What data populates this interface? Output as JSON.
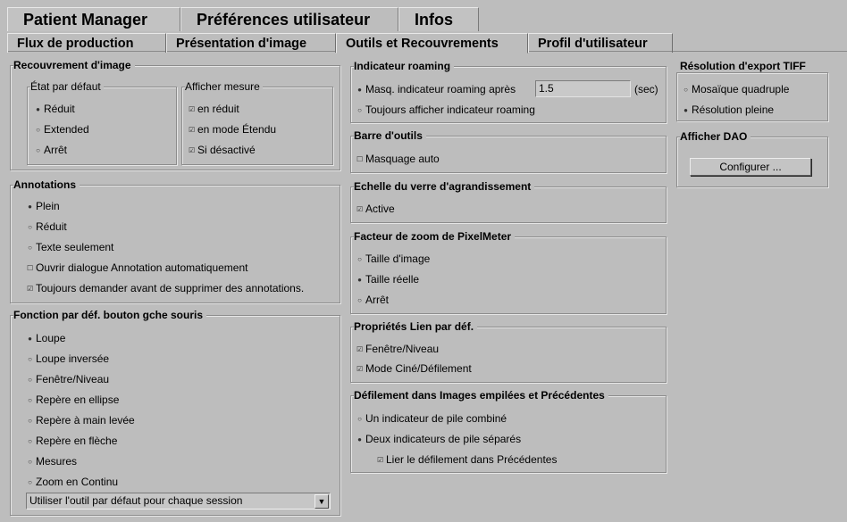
{
  "top_tabs": [
    {
      "label": "Patient Manager",
      "active": false
    },
    {
      "label": "Préférences utilisateur",
      "active": true
    },
    {
      "label": "Infos",
      "active": false
    }
  ],
  "sub_tabs": [
    {
      "label": "Flux de production"
    },
    {
      "label": "Présentation d'image"
    },
    {
      "label": "Outils et Recouvrements"
    },
    {
      "label": "Profil d'utilisateur"
    }
  ],
  "recouvrement": {
    "title": "Recouvrement d'image",
    "etat_title": "État par défaut",
    "etat_options": [
      "Réduit",
      "Extended",
      "Arrêt"
    ],
    "etat_selected": "Réduit",
    "mesure_title": "Afficher mesure",
    "mesure_options": [
      {
        "label": "en réduit",
        "checked": true
      },
      {
        "label": "en mode Étendu",
        "checked": true
      },
      {
        "label": "Si désactivé",
        "checked": true
      }
    ]
  },
  "annotations": {
    "title": "Annotations",
    "options": [
      "Plein",
      "Réduit",
      "Texte seulement"
    ],
    "selected": "Plein",
    "checks": [
      {
        "label": "Ouvrir dialogue Annotation automatiquement",
        "checked": false
      },
      {
        "label": "Toujours demander avant de supprimer des annotations.",
        "checked": true
      }
    ]
  },
  "mouse": {
    "title": "Fonction par déf. bouton gche souris",
    "options": [
      "Loupe",
      "Loupe inversée",
      "Fenêtre/Niveau",
      "Repère en ellipse",
      "Repère à main levée",
      "Repère en flèche",
      "Mesures",
      "Zoom en Continu"
    ],
    "selected": "Loupe",
    "dropdown_value": "Utiliser l'outil par défaut pour chaque session",
    "dropdown_arrow": "▼"
  },
  "roaming": {
    "title": "Indicateur roaming",
    "hide_label": "Masq. indicateur roaming après",
    "hide_value": "1.5",
    "unit": "(sec)",
    "always_label": "Toujours afficher indicateur roaming",
    "selected": "hide"
  },
  "toolbar_box": {
    "title": "Barre d'outils",
    "auto_hide_label": "Masquage auto",
    "auto_hide_checked": false
  },
  "magnifier": {
    "title": "Echelle du verre d'agrandissement",
    "active_label": "Active",
    "active_checked": true
  },
  "pixelmeter": {
    "title": "Facteur de zoom de PixelMeter",
    "options": [
      "Taille d'image",
      "Taille réelle",
      "Arrêt"
    ],
    "selected": "Taille réelle"
  },
  "link_props": {
    "title": "Propriétés Lien par déf.",
    "checks": [
      {
        "label": "Fenêtre/Niveau",
        "checked": true
      },
      {
        "label": "Mode Ciné/Défilement",
        "checked": true
      }
    ]
  },
  "scrolling": {
    "title": "Défilement dans Images empilées et Précédentes",
    "options": [
      "Un indicateur de pile combiné",
      "Deux indicateurs de pile séparés"
    ],
    "selected": "Deux indicateurs de pile séparés",
    "link_label": "Lier le défilement dans Précédentes",
    "link_checked": true
  },
  "tiff": {
    "title": "Résolution d'export TIFF",
    "options": [
      "Mosaïque quadruple",
      "Résolution pleine"
    ],
    "selected": "Résolution pleine"
  },
  "dao": {
    "title": "Afficher DAO",
    "button_label": "Configurer ..."
  },
  "glyphs": {
    "radio_on": "●",
    "radio_off": "○",
    "check_on": "☑",
    "check_off": "☐"
  }
}
